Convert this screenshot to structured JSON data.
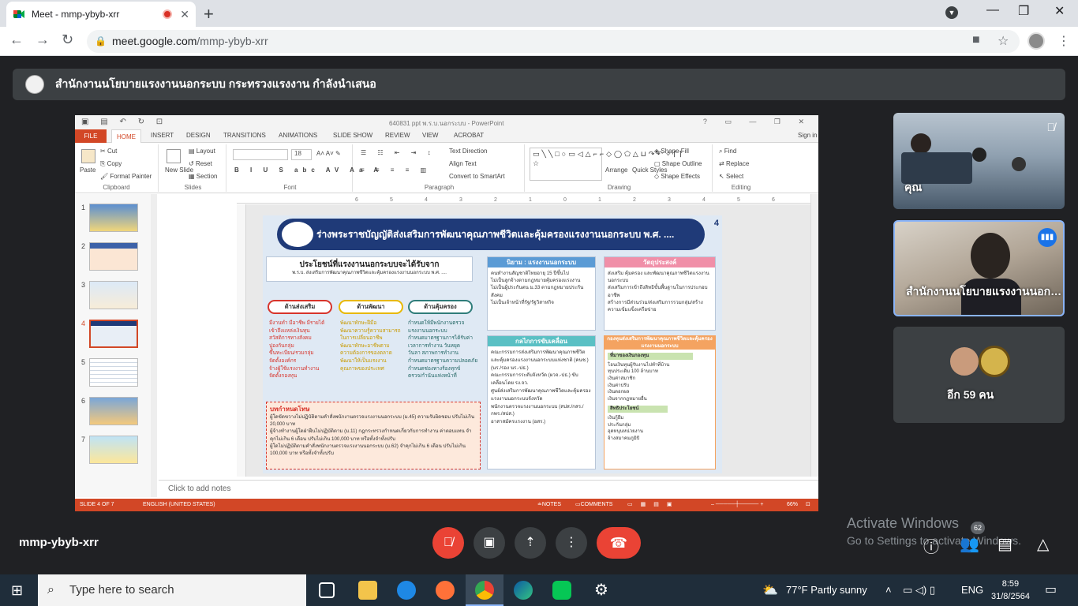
{
  "browser": {
    "tab_title": "Meet - mmp-ybyb-xrr",
    "url_domain": "meet.google.com",
    "url_path": "/mmp-ybyb-xrr"
  },
  "banner": {
    "text": "สำนักงานนโยบายแรงงานนอกระบบ กระทรวงแรงงาน กำลังนำเสนอ"
  },
  "ppt": {
    "doc_title": "640831 ppt พ.ร.บ.นอกระบบ - PowerPoint",
    "sign_in": "Sign in",
    "tabs": [
      "FILE",
      "HOME",
      "INSERT",
      "DESIGN",
      "TRANSITIONS",
      "ANIMATIONS",
      "SLIDE SHOW",
      "REVIEW",
      "VIEW",
      "ACROBAT"
    ],
    "ribbon": {
      "clipboard": {
        "label": "Clipboard",
        "paste": "Paste",
        "cut": "Cut",
        "copy": "Copy",
        "format_painter": "Format Painter"
      },
      "slides": {
        "label": "Slides",
        "new_slide": "New Slide",
        "layout": "Layout",
        "reset": "Reset",
        "section": "Section"
      },
      "font": {
        "label": "Font",
        "size": "18"
      },
      "paragraph": {
        "label": "Paragraph",
        "text_direction": "Text Direction",
        "align_text": "Align Text",
        "convert_smartart": "Convert to SmartArt"
      },
      "drawing": {
        "label": "Drawing",
        "arrange": "Arrange",
        "quick_styles": "Quick Styles",
        "shape_fill": "Shape Fill",
        "shape_outline": "Shape Outline",
        "shape_effects": "Shape Effects"
      },
      "editing": {
        "label": "Editing",
        "find": "Find",
        "replace": "Replace",
        "select": "Select"
      }
    },
    "thumb_numbers": [
      "1",
      "2",
      "3",
      "4",
      "5",
      "6",
      "7"
    ],
    "notes_placeholder": "Click to add notes",
    "status": {
      "slide": "SLIDE 4 OF 7",
      "language": "ENGLISH (UNITED STATES)",
      "notes": "NOTES",
      "comments": "COMMENTS",
      "zoom": "66%"
    },
    "ruler_marks": [
      "6",
      "5",
      "4",
      "3",
      "2",
      "1",
      "0",
      "1",
      "2",
      "3",
      "4",
      "5",
      "6"
    ]
  },
  "slide": {
    "number": "4",
    "title": "ร่างพระราชบัญญัติส่งเสริมการพัฒนาคุณภาพชีวิตและคุ้มครองแรงงานนอกระบบ พ.ศ. ....",
    "benefit_head": "ประโยชน์ที่แรงงานนอกระบบจะได้รับจาก",
    "benefit_sub": "พ.ร.บ. ส่งเสริมการพัฒนาคุณภาพชีวิตและคุ้มครองแรงงานนอกระบบ พ.ศ. ....",
    "pills": [
      "ด้านส่งเสริม",
      "ด้านพัฒนา",
      "ด้านคุ้มครอง"
    ],
    "col1": [
      "มีงานทำ มีอาชีพ มีรายได้",
      "เข้าถึงแหล่งเงินทุน",
      "สวัสดิการทางสังคม",
      "ปูองกันกลุ่ม",
      "ขึ้นทะเบียน/รวมกลุ่ม",
      "จัดตั้งองค์กร",
      "จ้างผู้ใช้แรงงานทำงาน",
      "จัดตั้งกองทุน"
    ],
    "col2": [
      "พัฒนาทักษะฝีมือ",
      "พัฒนาความรู้ความสามารถ",
      "ในการเปลี่ยนอาชีพ",
      "พัฒนาทักษะอาชีพตาม",
      "ความต้องการของตลาด",
      "พัฒนาให้เป็นแรงงาน",
      "คุณภาพของประเทศ"
    ],
    "col3": [
      "กำหนดให้มีพนักงานตรวจ",
      "แรงงานนอกระบบ",
      "กำหนดมาตรฐานการได้รับค่า",
      "เวลาการทำงาน วันหยุด",
      "วันลา สภาพการทำงาน",
      "กำหนดมาตรฐานความปลอดภัย",
      "กำหนดช่องทางร้องทุกข์",
      "ตรวจ/กำนันแห่งหน้าที่"
    ],
    "penalty_head": "บทกำหนดโทษ",
    "penalty": [
      "ผู้ใดขัดขวางไม่ปฏิบัติตามคำสั่งพนักงานตรวจแรงงานนอกระบบ (ม.45) ความรับผิดชอบ ปรับไม่เกิน 20,000 บาท",
      "ผู้จ้างทำงานผู้ใดฝ่าฝืนไม่ปฏิบัติตาม (ม.11) กฎกระทรวงกำหนดเกี่ยวกับการทำงาน ค่าตอบแทน จำคุกไม่เกิน 6 เดือน ปรับไม่เกิน 100,000 บาท หรือทั้งจำทั้งปรับ",
      "ผู้ใดไม่ปฏิบัติตามคำสั่งพนักงานตรวจแรงงานนอกระบบ (ม.62) จำคุกไม่เกิน 6 เดือน ปรับไม่เกิน 100,000 บาท หรือทั้งจำทั้งปรับ"
    ],
    "def_head": "นิยาม : แรงงานนอกระบบ",
    "def_items": [
      "คนทำงานสัญชาติไทยอายุ 15 ปีขึ้นไป",
      "ไม่เป็นลูกจ้างตามกฎหมายคุ้มครองแรงงาน",
      "ไม่เป็นผู้ประกันตน ม.33 ตามกฎหมายประกันสังคม",
      "ไม่เป็นเจ้าหน้าที่รัฐ/รัฐวิสาหกิจ"
    ],
    "obj_head": "วัตถุประสงค์",
    "obj_items": [
      "ส่งเสริม คุ้มครอง และพัฒนาคุณภาพชีวิตแรงงานนอกระบบ",
      "ส่งเสริมการเข้าถึงสิทธิขั้นพื้นฐานในการประกอบอาชีพ",
      "สร้างการมีส่วนร่วม/ส่งเสริมการรวมกลุ่ม/สร้างความเข้มแข็งเครือข่าย"
    ],
    "mech_head": "กลไกการขับเคลื่อน",
    "mech_items": [
      "คณะกรรมการส่งเสริมการพัฒนาคุณภาพชีวิตและคุ้มครองแรงงานนอกระบบแห่งชาติ (คนช.) (นร./รอง นร.-ปธ.)",
      "คณะกรรมการระดับจังหวัด (ผวจ.-ปธ.) ขับเคลื่อนโดย รง.จว.",
      "ศูนย์ส่งเสริมการพัฒนาคุณภาพชีวิตและคุ้มครองแรงงานนอกระบบจังหวัด",
      "พนักงานตรวจแรงงานนอกระบบ (สปส./กสร./กพร./สปส.)",
      "อาสาสมัครแรงงาน (อสร.)"
    ],
    "fund_head": "กองทุนส่งเสริมการพัฒนาคุณภาพชีวิตและคุ้มครองแรงงานนอกระบบ",
    "fund_src_head": "ที่มาของเงินกองทุน",
    "fund_src": [
      "โอนเงินทุนผู้รับงานไปทำที่บ้าน",
      "ทุนประเดิม 100 ล้านบาท",
      "เงินค่าสมาชิก",
      "เงินค่าปรับ",
      "เงินดอกผล",
      "เงินจากกฎหมายอื่น"
    ],
    "fund_ben_head": "สิทธิประโยชน์",
    "fund_ben": [
      "เงินกู้ยืม",
      "ประกันกลุ่ม",
      "อุดหนุนหน่วยงาน",
      "จ้างสมาคมภูมิบิ"
    ]
  },
  "tiles": {
    "t1_name": "คุณ",
    "t2_name": "สำนักงานนโยบายแรงงานนอก…",
    "t3_name": "อีก 59 คน"
  },
  "meet": {
    "code": "mmp-ybyb-xrr",
    "participant_count": "62"
  },
  "watermark": {
    "line1": "Activate Windows",
    "line2": "Go to Settings to activate Windows."
  },
  "taskbar": {
    "search_placeholder": "Type here to search",
    "weather": "77°F  Partly sunny",
    "lang": "ENG",
    "time": "8:59",
    "date": "31/8/2564"
  }
}
